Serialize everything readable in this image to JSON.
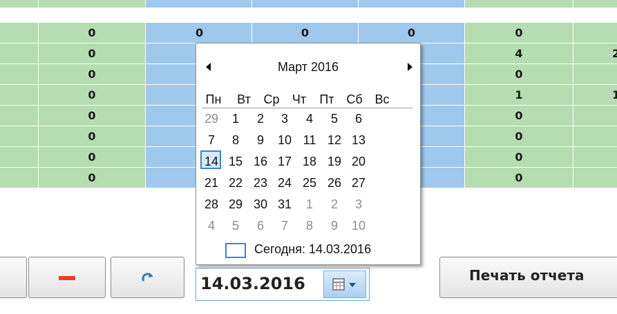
{
  "grid": {
    "rows": [
      {
        "c1": "0",
        "c2": "0",
        "c3": "0",
        "c4": "0",
        "c5": "0",
        "c6": ""
      },
      {
        "c1": "0",
        "c2": "",
        "c3": "",
        "c4": "",
        "c5": "4",
        "c6": "2"
      },
      {
        "c1": "0",
        "c2": "",
        "c3": "",
        "c4": "",
        "c5": "0",
        "c6": ""
      },
      {
        "c1": "0",
        "c2": "",
        "c3": "",
        "c4": "",
        "c5": "1",
        "c6": "1"
      },
      {
        "c1": "0",
        "c2": "",
        "c3": "",
        "c4": "",
        "c5": "0",
        "c6": ""
      },
      {
        "c1": "0",
        "c2": "",
        "c3": "",
        "c4": "",
        "c5": "0",
        "c6": ""
      },
      {
        "c1": "0",
        "c2": "",
        "c3": "",
        "c4": "",
        "c5": "0",
        "c6": ""
      },
      {
        "c1": "0",
        "c2": "",
        "c3": "",
        "c4": "",
        "c5": "0",
        "c6": ""
      }
    ],
    "colors": {
      "green": "#b5ddb1",
      "blue": "#9fc9ec"
    }
  },
  "toolbar": {
    "remove_icon": "minus-icon",
    "refresh_icon": "refresh-icon",
    "date_value": "14.03.2016",
    "calendar_icon": "calendar-icon",
    "print_label": "Печать отчета"
  },
  "calendar": {
    "title": "Март 2016",
    "weekdays": [
      "Пн",
      "Вт",
      "Ср",
      "Чт",
      "Пт",
      "Сб",
      "Вс"
    ],
    "weeks": [
      [
        "29",
        "1",
        "2",
        "3",
        "4",
        "5",
        "6"
      ],
      [
        "7",
        "8",
        "9",
        "10",
        "11",
        "12",
        "13"
      ],
      [
        "14",
        "15",
        "16",
        "17",
        "18",
        "19",
        "20"
      ],
      [
        "21",
        "22",
        "23",
        "24",
        "25",
        "26",
        "27"
      ],
      [
        "28",
        "29",
        "30",
        "31",
        "1",
        "2",
        "3"
      ],
      [
        "4",
        "5",
        "6",
        "7",
        "8",
        "9",
        "10"
      ]
    ],
    "other_month": [
      [
        true,
        false,
        false,
        false,
        false,
        false,
        false
      ],
      [
        false,
        false,
        false,
        false,
        false,
        false,
        false
      ],
      [
        false,
        false,
        false,
        false,
        false,
        false,
        false
      ],
      [
        false,
        false,
        false,
        false,
        false,
        false,
        false
      ],
      [
        false,
        false,
        false,
        false,
        true,
        true,
        true
      ],
      [
        true,
        true,
        true,
        true,
        true,
        true,
        true
      ]
    ],
    "selected": "14",
    "today_label": "Сегодня: 14.03.2016"
  }
}
